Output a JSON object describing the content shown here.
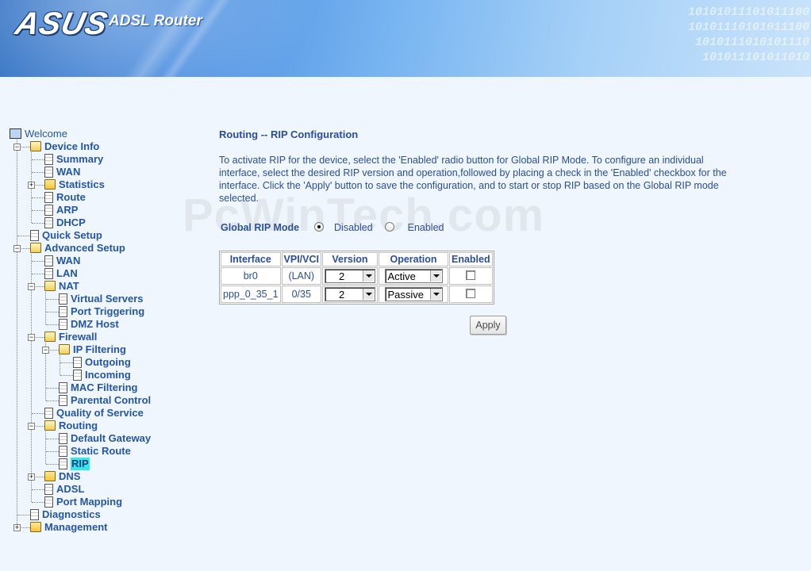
{
  "banner": {
    "brand": "ASUS",
    "product": "ADSL Router",
    "binary_lines": [
      "10101011101011100",
      "10101110101011100",
      "1010111010101110",
      "101011101011010"
    ]
  },
  "sidebar": {
    "nodes": [
      {
        "label": "Welcome",
        "icon": "monitor-icon",
        "level": 0,
        "expander": ""
      },
      {
        "label": "Device Info",
        "icon": "folder-open-icon",
        "level": 1,
        "expander": "−"
      },
      {
        "label": "Summary",
        "icon": "document-icon",
        "level": 2,
        "expander": ""
      },
      {
        "label": "WAN",
        "icon": "document-icon",
        "level": 2,
        "expander": ""
      },
      {
        "label": "Statistics",
        "icon": "folder-icon",
        "level": 2,
        "expander": "+"
      },
      {
        "label": "Route",
        "icon": "document-icon",
        "level": 2,
        "expander": ""
      },
      {
        "label": "ARP",
        "icon": "document-icon",
        "level": 2,
        "expander": ""
      },
      {
        "label": "DHCP",
        "icon": "document-icon",
        "level": 2,
        "expander": ""
      },
      {
        "label": "Quick Setup",
        "icon": "document-icon",
        "level": 1,
        "expander": ""
      },
      {
        "label": "Advanced Setup",
        "icon": "folder-open-icon",
        "level": 1,
        "expander": "−"
      },
      {
        "label": "WAN",
        "icon": "document-icon",
        "level": 2,
        "expander": ""
      },
      {
        "label": "LAN",
        "icon": "document-icon",
        "level": 2,
        "expander": ""
      },
      {
        "label": "NAT",
        "icon": "folder-open-icon",
        "level": 2,
        "expander": "−"
      },
      {
        "label": "Virtual Servers",
        "icon": "document-icon",
        "level": 3,
        "expander": ""
      },
      {
        "label": "Port Triggering",
        "icon": "document-icon",
        "level": 3,
        "expander": ""
      },
      {
        "label": "DMZ Host",
        "icon": "document-icon",
        "level": 3,
        "expander": ""
      },
      {
        "label": "Firewall",
        "icon": "folder-open-icon",
        "level": 2,
        "expander": "−"
      },
      {
        "label": "IP Filtering",
        "icon": "folder-open-icon",
        "level": 3,
        "expander": "−"
      },
      {
        "label": "Outgoing",
        "icon": "document-icon",
        "level": 4,
        "expander": ""
      },
      {
        "label": "Incoming",
        "icon": "document-icon",
        "level": 4,
        "expander": ""
      },
      {
        "label": "MAC Filtering",
        "icon": "document-icon",
        "level": 3,
        "expander": ""
      },
      {
        "label": "Parental Control",
        "icon": "document-icon",
        "level": 3,
        "expander": ""
      },
      {
        "label": "Quality of Service",
        "icon": "document-icon",
        "level": 2,
        "expander": ""
      },
      {
        "label": "Routing",
        "icon": "folder-open-icon",
        "level": 2,
        "expander": "−"
      },
      {
        "label": "Default Gateway",
        "icon": "document-icon",
        "level": 3,
        "expander": ""
      },
      {
        "label": "Static Route",
        "icon": "document-icon",
        "level": 3,
        "expander": ""
      },
      {
        "label": "RIP",
        "icon": "document-icon",
        "level": 3,
        "expander": "",
        "selected": true
      },
      {
        "label": "DNS",
        "icon": "folder-icon",
        "level": 2,
        "expander": "+"
      },
      {
        "label": "ADSL",
        "icon": "document-icon",
        "level": 2,
        "expander": ""
      },
      {
        "label": "Port Mapping",
        "icon": "document-icon",
        "level": 2,
        "expander": ""
      },
      {
        "label": "Diagnostics",
        "icon": "document-icon",
        "level": 1,
        "expander": ""
      },
      {
        "label": "Management",
        "icon": "folder-icon",
        "level": 1,
        "expander": "+"
      }
    ]
  },
  "main": {
    "title": "Routing -- RIP Configuration",
    "description": "To activate RIP for the device, select the 'Enabled' radio button for Global RIP Mode. To configure an individual interface, select the desired RIP version and operation,followed by placing a check in the 'Enabled' checkbox for the interface. Click the 'Apply' button to save the configuration, and to start or stop RIP based on the Global RIP mode selected.",
    "global_mode": {
      "label": "Global RIP Mode",
      "options": [
        "Disabled",
        "Enabled"
      ],
      "selected": "Disabled"
    },
    "table": {
      "headers": [
        "Interface",
        "VPI/VCI",
        "Version",
        "Operation",
        "Enabled"
      ],
      "rows": [
        {
          "interface": "br0",
          "vpivci": "(LAN)",
          "version": "2",
          "operation": "Active",
          "enabled": false
        },
        {
          "interface": "ppp_0_35_1",
          "vpivci": "0/35",
          "version": "2",
          "operation": "Passive",
          "enabled": false
        }
      ]
    },
    "apply_label": "Apply"
  },
  "watermark": "PcWinTech.com",
  "colors": {
    "link_blue": "#2455a6",
    "text_blue": "#2b4d9c",
    "selected_bg": "#33e8ea",
    "page_bg": "#f0f6fd"
  }
}
